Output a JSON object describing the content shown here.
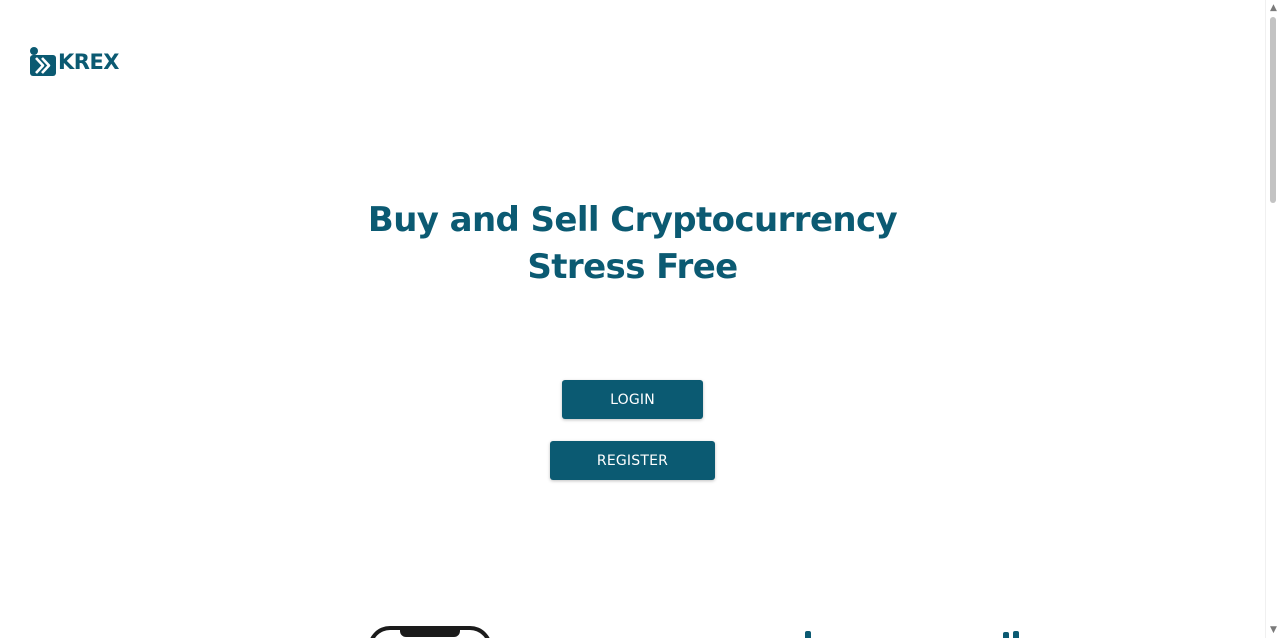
{
  "brand": {
    "name": "KREX",
    "color": "#0b5a72"
  },
  "hero": {
    "line1": "Buy and Sell Cryptocurrency",
    "line2": "Stress Free"
  },
  "actions": {
    "login_label": "LOGIN",
    "register_label": "REGISTER"
  },
  "scrollbar": {
    "up_icon": "chevron-up-icon",
    "down_icon": "chevron-down-icon"
  }
}
